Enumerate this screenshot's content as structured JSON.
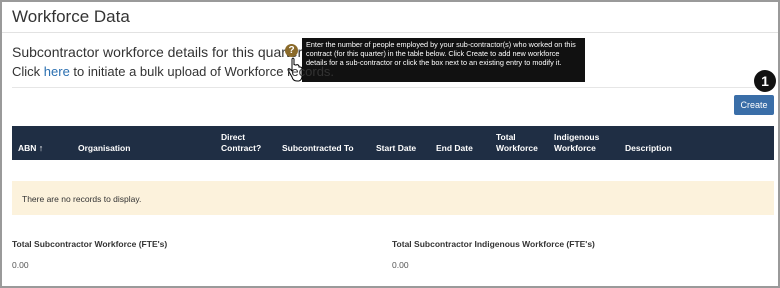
{
  "page": {
    "title": "Workforce Data",
    "subtitle": "Subcontractor workforce details for this quarter (FTE)",
    "bulk_prefix": "Click ",
    "bulk_link": "here",
    "bulk_suffix": " to initiate a bulk upload of Workforce records.",
    "tooltip": "Enter the number of people employed by your sub-contractor(s) who worked on this contract (for this quarter) in the table below. Click Create to add new workforce details for a sub-contractor or click the box next to an existing entry to modify it."
  },
  "toolbar": {
    "create_label": "Create",
    "step_badge": "1"
  },
  "table": {
    "columns": [
      "ABN",
      "Organisation",
      "Direct Contract?",
      "Subcontracted To",
      "Start Date",
      "End Date",
      "Total Workforce",
      "Indigenous Workforce",
      "Description"
    ],
    "empty_message": "There are no records to display."
  },
  "totals": {
    "subcontractor_label": "Total Subcontractor Workforce (FTE's)",
    "subcontractor_value": "0.00",
    "indigenous_label": "Total Subcontractor Indigenous Workforce (FTE's)",
    "indigenous_value": "0.00"
  },
  "colors": {
    "header_bg": "#1f2e44",
    "create_button": "#3a6ea8",
    "empty_bg": "#fcf2dc",
    "link": "#2a6fb0",
    "help_icon": "#8a6a2a"
  },
  "icons": [
    "help-icon",
    "sort-arrow-up-icon",
    "hand-cursor-icon"
  ]
}
